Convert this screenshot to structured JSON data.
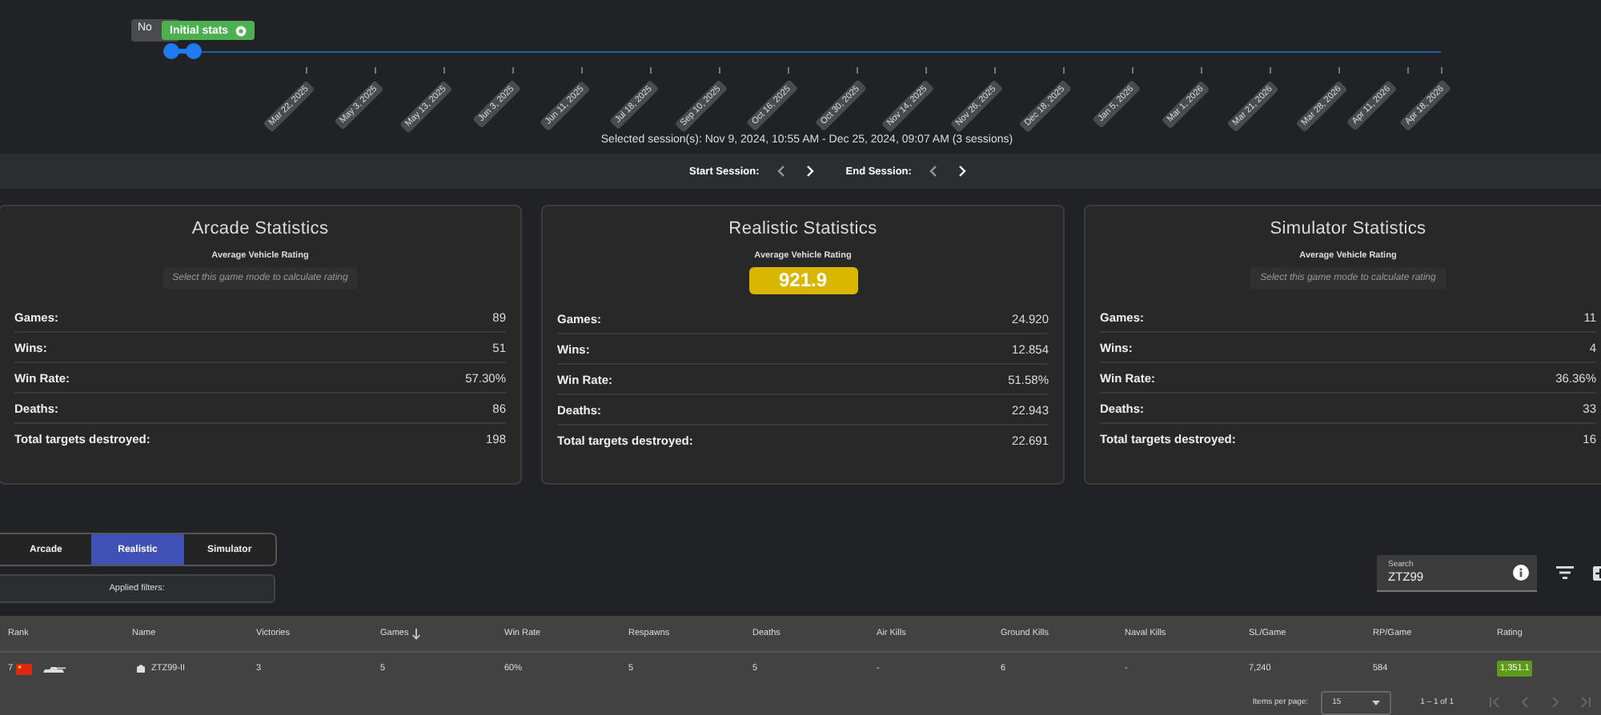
{
  "timeline": {
    "tooltips": [
      {
        "kind": "date",
        "label": "No"
      },
      {
        "kind": "session",
        "label": "Initial stats"
      }
    ],
    "ticks": [
      "Mar 22, 2025",
      "May 3, 2025",
      "May 13, 2025",
      "Jun 3, 2025",
      "Jun 11, 2025",
      "Jul 18, 2025",
      "Sep 10, 2025",
      "Oct 16, 2025",
      "Oct 30, 2025",
      "Nov 14, 2025",
      "Nov 26, 2025",
      "Dec 18, 2025",
      "Jan 5, 2026",
      "Mar 1, 2026",
      "Mar 21, 2026",
      "Mar 28, 2026",
      "Apr 11, 2026",
      "Apr 18, 2026"
    ],
    "selection_text": "Selected session(s): Nov 9, 2024, 10:55 AM - Dec 25, 2024, 09:07 AM (3 sessions)"
  },
  "session_bar": {
    "start_label": "Start Session:",
    "end_label": "End Session:"
  },
  "stat_cards": [
    {
      "title": "Arcade Statistics",
      "rating_label": "Average Vehicle Rating",
      "rating": {
        "kind": "placeholder",
        "text": "Select this game mode to calculate rating"
      },
      "rows": [
        {
          "label": "Games:",
          "value": "89"
        },
        {
          "label": "Wins:",
          "value": "51"
        },
        {
          "label": "Win Rate:",
          "value": "57.30%"
        },
        {
          "label": "Deaths:",
          "value": "86"
        },
        {
          "label": "Total targets destroyed:",
          "value": "198"
        }
      ]
    },
    {
      "title": "Realistic Statistics",
      "rating_label": "Average Vehicle Rating",
      "rating": {
        "kind": "value",
        "text": "921.9"
      },
      "rows": [
        {
          "label": "Games:",
          "value": "24.920"
        },
        {
          "label": "Wins:",
          "value": "12.854"
        },
        {
          "label": "Win Rate:",
          "value": "51.58%"
        },
        {
          "label": "Deaths:",
          "value": "22.943"
        },
        {
          "label": "Total targets destroyed:",
          "value": "22.691"
        }
      ]
    },
    {
      "title": "Simulator Statistics",
      "rating_label": "Average Vehicle Rating",
      "rating": {
        "kind": "placeholder",
        "text": "Select this game mode to calculate rating"
      },
      "rows": [
        {
          "label": "Games:",
          "value": "11"
        },
        {
          "label": "Wins:",
          "value": "4"
        },
        {
          "label": "Win Rate:",
          "value": "36.36%"
        },
        {
          "label": "Deaths:",
          "value": "33"
        },
        {
          "label": "Total targets destroyed:",
          "value": "16"
        }
      ]
    }
  ],
  "mode_tabs": [
    {
      "label": "Arcade",
      "selected": false
    },
    {
      "label": "Realistic",
      "selected": true
    },
    {
      "label": "Simulator",
      "selected": false
    }
  ],
  "applied_filters": "Applied filters:",
  "search": {
    "label": "Search",
    "value": "ZTZ99"
  },
  "table": {
    "columns": [
      {
        "label": "Rank",
        "sorted": false
      },
      {
        "label": "Name",
        "sorted": false
      },
      {
        "label": "Victories",
        "sorted": false
      },
      {
        "label": "Games",
        "sorted": true
      },
      {
        "label": "Win Rate",
        "sorted": false
      },
      {
        "label": "Respawns",
        "sorted": false
      },
      {
        "label": "Deaths",
        "sorted": false
      },
      {
        "label": "Air Kills",
        "sorted": false
      },
      {
        "label": "Ground Kills",
        "sorted": false
      },
      {
        "label": "Naval Kills",
        "sorted": false
      },
      {
        "label": "SL/Game",
        "sorted": false
      },
      {
        "label": "RP/Game",
        "sorted": false
      },
      {
        "label": "Rating",
        "sorted": false
      }
    ],
    "rows": [
      {
        "cells": [
          "7",
          "ZTZ99-II",
          "3",
          "5",
          "60%",
          "5",
          "5",
          "-",
          "6",
          "-",
          "7,240",
          "584",
          "1,351.1"
        ]
      }
    ]
  },
  "pagination": {
    "items_label": "Items per page:",
    "page_size": "15",
    "range": "1 – 1 of 1"
  }
}
